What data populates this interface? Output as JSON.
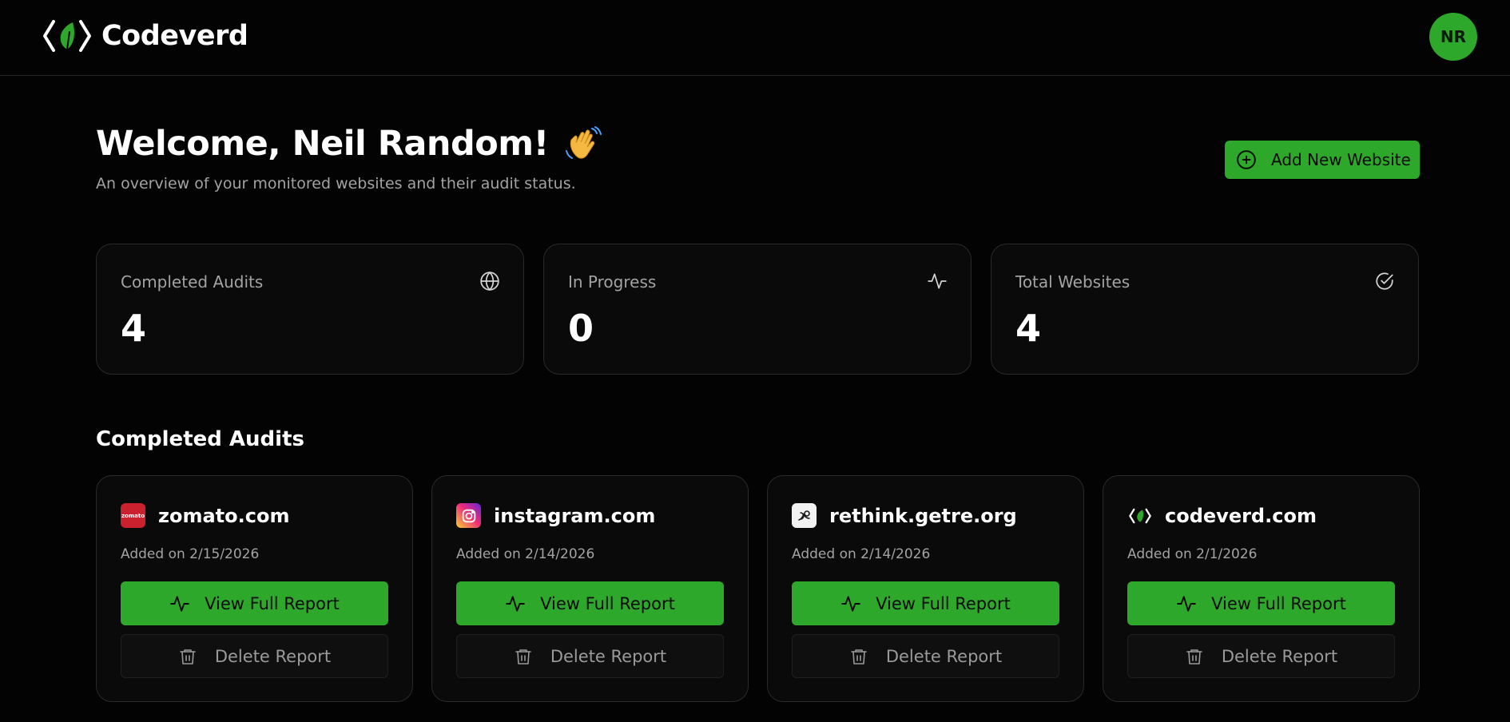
{
  "brand": {
    "name": "Codeverd",
    "logo_icon": "codeverd-leaf-logo"
  },
  "user": {
    "initials": "NR"
  },
  "welcome": {
    "title": "Welcome, Neil Random!",
    "subtitle": "An overview of your monitored websites and their audit status."
  },
  "actions": {
    "add_website": "Add New Website"
  },
  "stats": [
    {
      "label": "Completed Audits",
      "value": "4",
      "icon": "globe-icon"
    },
    {
      "label": "In Progress",
      "value": "0",
      "icon": "activity-icon"
    },
    {
      "label": "Total Websites",
      "value": "4",
      "icon": "check-circle-icon"
    }
  ],
  "section": {
    "title": "Completed Audits"
  },
  "sites": [
    {
      "name": "zomato.com",
      "added": "Added on 2/15/2026",
      "favicon_text": "zomato",
      "view": "View Full Report",
      "delete": "Delete Report"
    },
    {
      "name": "instagram.com",
      "added": "Added on 2/14/2026",
      "view": "View Full Report",
      "delete": "Delete Report"
    },
    {
      "name": "rethink.getre.org",
      "added": "Added on 2/14/2026",
      "view": "View Full Report",
      "delete": "Delete Report"
    },
    {
      "name": "codeverd.com",
      "added": "Added on 2/1/2026",
      "view": "View Full Report",
      "delete": "Delete Report"
    }
  ],
  "colors": {
    "accent": "#2ea82a",
    "background": "#030303",
    "card": "#0a0a0a",
    "muted": "#a3a3a3"
  }
}
